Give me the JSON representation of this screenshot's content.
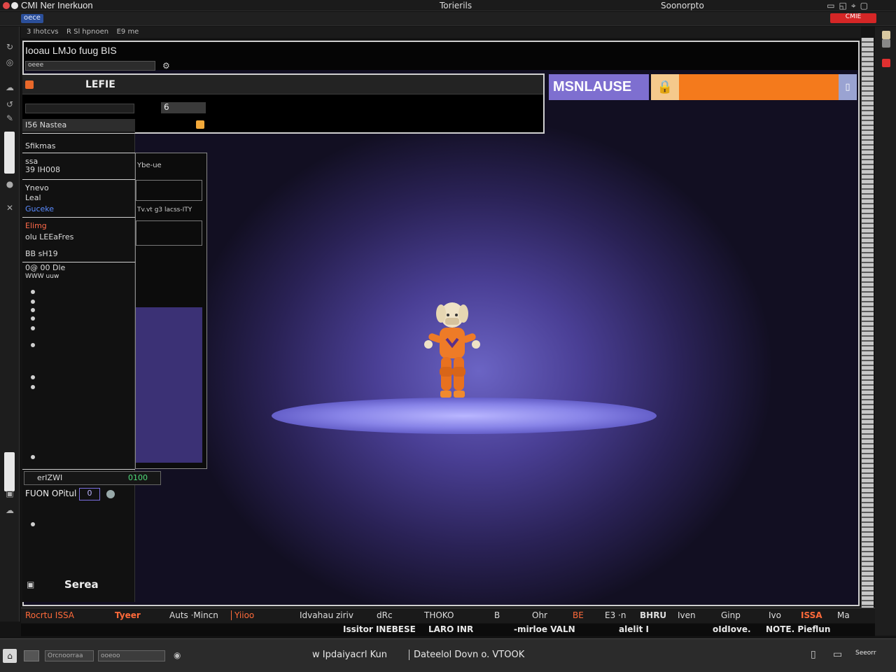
{
  "window": {
    "app_title": "CMI Ner Inerkuon",
    "center_title": "Torierils",
    "right_title": "Soonorpto"
  },
  "toolbar": {
    "pill": "oece",
    "red_button": "CMIE"
  },
  "breadcrumb": [
    "3 Ihotcvs",
    "R  Sl hpnoen",
    "E9 me"
  ],
  "viewport": {
    "title": "Iooau LMJo fuug BIS",
    "search_placeholder": "oeee",
    "panel_label": "LEFIE",
    "button_label": "6"
  },
  "banner": {
    "label": "MSNLAUSE",
    "icon": "lock-icon",
    "accent_purple": "#7e6fd0",
    "accent_orange": "#f47a1c"
  },
  "outliner": {
    "header": "I56 Nastea",
    "rows": [
      {
        "label": "Sfikmas"
      },
      {
        "label": "ssa"
      },
      {
        "label": "39 IH008"
      },
      {
        "label": "Ynevo"
      },
      {
        "label": "Leal"
      },
      {
        "label": "Guceke"
      },
      {
        "label": "Elimg"
      },
      {
        "label": "olu LEEaFres"
      },
      {
        "label": "BB  sH19"
      },
      {
        "label": "0@ 00 Dle"
      },
      {
        "label": "WWW  uuw"
      }
    ],
    "tree_label": "Ybe-ue",
    "path_label": "Tv.vt g3 lacss-ITY"
  },
  "status": {
    "label": "erIZWI",
    "value": "0100"
  },
  "fusion": {
    "label": "FUON OPitul",
    "box": "0"
  },
  "scene": {
    "label": "Serea"
  },
  "tabs": [
    {
      "label": "Rocrtu ISSA"
    },
    {
      "label": "Tyeer",
      "active": true
    },
    {
      "label": "Auts ·Mincn"
    },
    {
      "label": "Yiioo",
      "active": true
    },
    {
      "label": "Idvahau ziriv"
    },
    {
      "label": "dRc"
    },
    {
      "label": "THOKO"
    },
    {
      "label": "B"
    },
    {
      "label": "Ohr"
    },
    {
      "label": "BE",
      "active": true
    },
    {
      "label": "E3 ·n"
    },
    {
      "label": "BHRU"
    },
    {
      "label": "Iven"
    },
    {
      "label": "Ginp"
    },
    {
      "label": "Ivo"
    },
    {
      "label": "ISSA",
      "active": true
    },
    {
      "label": "Ma"
    }
  ],
  "subbar": [
    "Issitor INEBESE",
    "LARO INR",
    "-mirloe VALN",
    "alelit I",
    "oIdIove.",
    "NOTE. Pieflun"
  ],
  "bottombar": {
    "field1": "Orcnoorraa",
    "field2": "ooeoo",
    "center_text": "w Ipdaiyacrl  Kun",
    "right_text": "Dateelol Dovn  o. VTOOK",
    "far_right": "Seeorr"
  }
}
